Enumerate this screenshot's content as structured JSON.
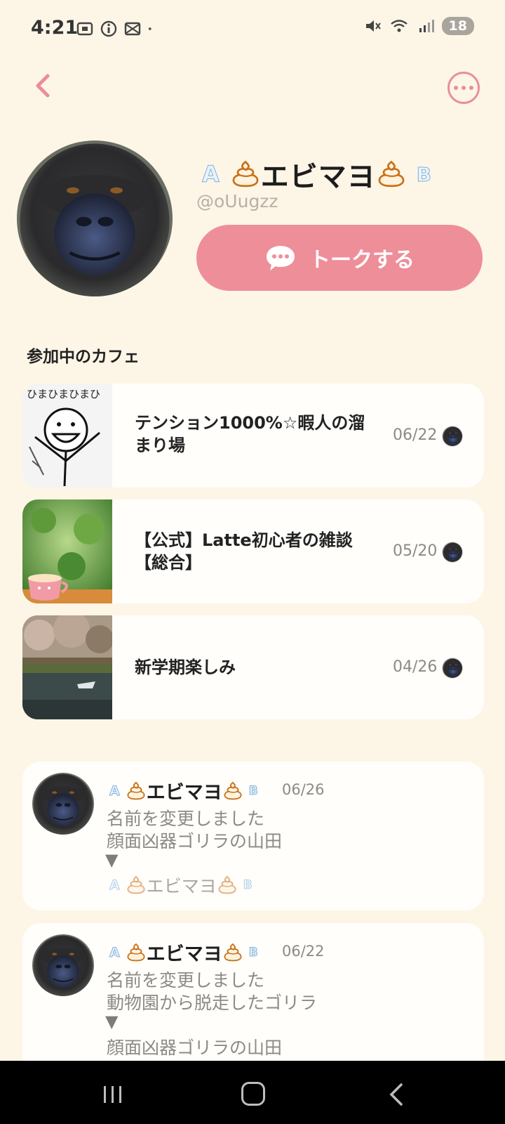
{
  "status_bar": {
    "time": "4:21",
    "battery": "18"
  },
  "profile": {
    "name_prefix": "A",
    "name": "エビマヨ",
    "name_suffix": "B",
    "handle": "@oUugzz",
    "talk_button": "トークする"
  },
  "cafes": {
    "section_title": "参加中のカフェ",
    "items": [
      {
        "title": "テンション1000%☆暇人の溜まり場",
        "date": "06/22"
      },
      {
        "title": "【公式】Latte初心者の雑談【総合】",
        "date": "05/20"
      },
      {
        "title": "新学期楽しみ",
        "date": "04/26"
      }
    ]
  },
  "activity": [
    {
      "name_prefix": "A",
      "name": "エビマヨ",
      "name_suffix": "B",
      "date": "06/26",
      "line1": "名前を変更しました",
      "line2": "顔面凶器ゴリラの山田",
      "arrow": "▼",
      "new_prefix": "A",
      "new_name": "エビマヨ",
      "new_suffix": "B"
    },
    {
      "name_prefix": "A",
      "name": "エビマヨ",
      "name_suffix": "B",
      "date": "06/22",
      "line1": "名前を変更しました",
      "line2": "動物園から脱走したゴリラ",
      "arrow": "▼",
      "line3": "顔面凶器ゴリラの山田"
    }
  ],
  "icons": {
    "back": "chevron-left-icon",
    "more": "more-dots-icon",
    "talk": "chat-bubble-icon",
    "poo": "poo-icon"
  },
  "colors": {
    "accent": "#ee8e99",
    "background": "#fdf6e7",
    "card": "#fffefb"
  }
}
